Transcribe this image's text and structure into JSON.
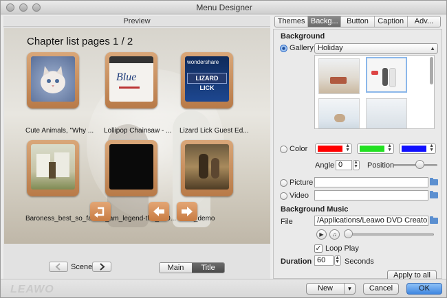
{
  "window": {
    "title": "Menu Designer"
  },
  "preview": {
    "label": "Preview",
    "page_title": "Chapter list pages 1 / 2",
    "thumbs": [
      {
        "caption": "Cute Animals, \"Why ..."
      },
      {
        "caption": "Lollipop Chainsaw - ...",
        "inner_text": "Blue"
      },
      {
        "caption": "Lizard Lick Guest Ed...",
        "brand": "wondershare",
        "inner_text": "LIZARD LICK"
      },
      {
        "caption": "Baroness_best_so_fa..."
      },
      {
        "caption": "i_am_legend-tlr1_h10..."
      },
      {
        "caption": "hdtv_demo"
      }
    ]
  },
  "scene": {
    "label": "Scene",
    "segments": [
      "Main",
      "Title"
    ],
    "active": "Title"
  },
  "tabs": {
    "items": [
      "Themes",
      "Backg...",
      "Button",
      "Caption",
      "Adv..."
    ],
    "active": 1
  },
  "background": {
    "section_title": "Background",
    "gallery_label": "Gallery",
    "gallery_value": "Holiday",
    "color_label": "Color",
    "colors": [
      "#ff0000",
      "#22e022",
      "#1010ff"
    ],
    "angle_label": "Angle",
    "angle_value": "0",
    "position_label": "Position",
    "position_level": 0.6,
    "picture_label": "Picture",
    "picture_value": "",
    "video_label": "Video",
    "video_value": ""
  },
  "music": {
    "section_title": "Background Music",
    "file_label": "File",
    "file_value": "/Applications/Leawo DVD Creator.ap",
    "loop_label": "Loop Play",
    "loop_checked": true,
    "duration_label": "Duration",
    "duration_value": "60",
    "seconds_label": "Seconds",
    "apply_label": "Apply to all"
  },
  "footer": {
    "logo": "LEAWO",
    "new_label": "New",
    "cancel_label": "Cancel",
    "ok_label": "OK"
  }
}
